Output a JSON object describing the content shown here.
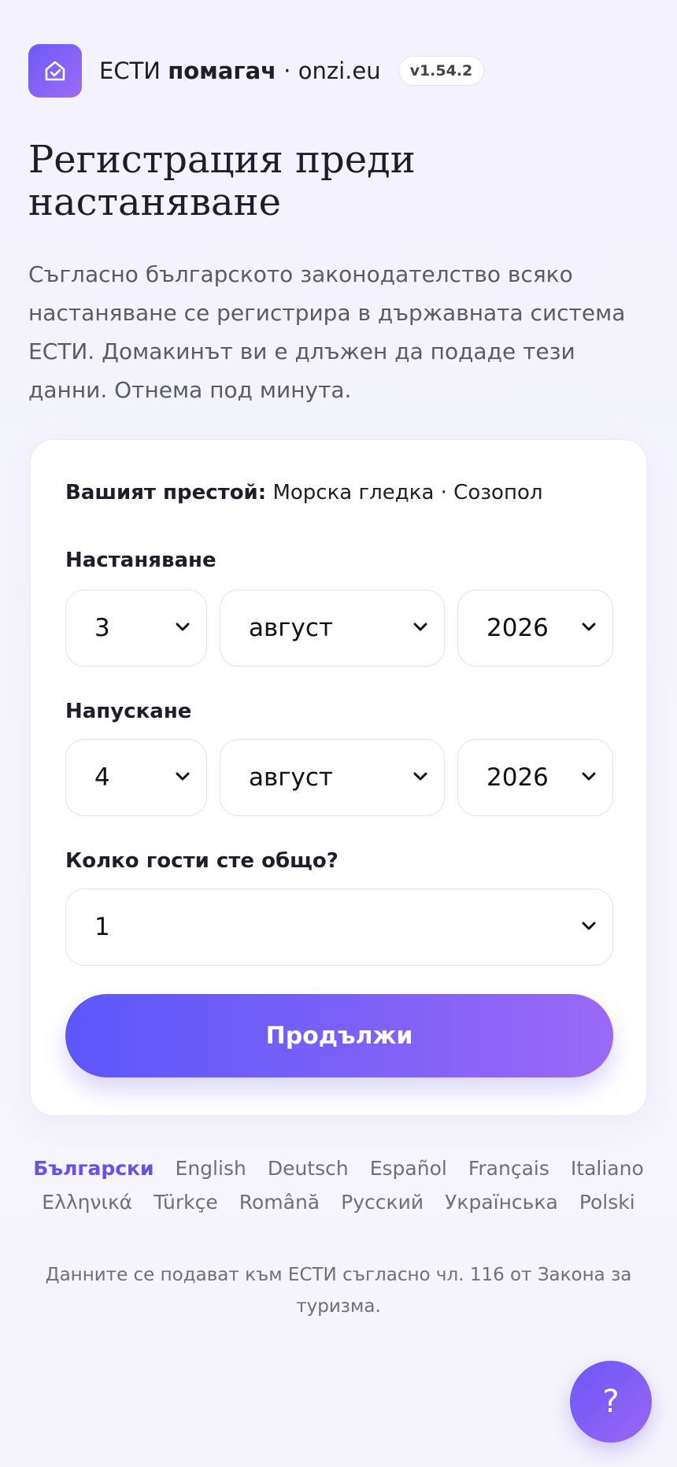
{
  "header": {
    "brand_prefix": "ЕСТИ ",
    "brand_bold": "помагач",
    "brand_suffix": " · onzi.eu",
    "version": "v1.54.2",
    "logo_icon": "home-check-icon"
  },
  "page": {
    "title": "Регистрация преди настаняване",
    "intro": "Съгласно българското законодателство всяко настаняване се регистрира в държавната система ЕСТИ. Домакинът ви е длъжен да подаде тези данни. Отнема под минута."
  },
  "form": {
    "stay_label": "Вашият престой:",
    "stay_value": "Морска гледка · Созопол",
    "checkin": {
      "label": "Настаняване",
      "day": "3",
      "month": "август",
      "year": "2026"
    },
    "checkout": {
      "label": "Напускане",
      "day": "4",
      "month": "август",
      "year": "2026"
    },
    "guests": {
      "label": "Колко гости сте общо?",
      "value": "1"
    },
    "submit_label": "Продължи"
  },
  "languages": [
    {
      "label": "Български",
      "active": true
    },
    {
      "label": "English"
    },
    {
      "label": "Deutsch"
    },
    {
      "label": "Español"
    },
    {
      "label": "Français"
    },
    {
      "label": "Italiano"
    },
    {
      "label": "Ελληνικά"
    },
    {
      "label": "Türkçe"
    },
    {
      "label": "Română"
    },
    {
      "label": "Русский"
    },
    {
      "label": "Українська"
    },
    {
      "label": "Polski"
    }
  ],
  "footer": {
    "note": "Данните се подават към ЕСТИ съгласно чл. 116 от Закона за туризма."
  },
  "help": {
    "label": "?",
    "icon": "help-icon"
  },
  "colors": {
    "accent": "#6a4fe8",
    "button_start": "#5d56fb",
    "button_end": "#9b69f6"
  }
}
